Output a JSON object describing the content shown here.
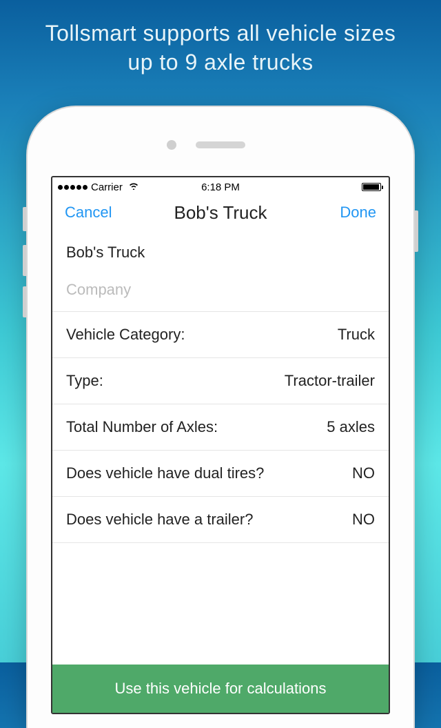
{
  "promo": {
    "line1": "Tollsmart supports all vehicle sizes",
    "line2": "up to 9 axle trucks"
  },
  "statusBar": {
    "carrier": "Carrier",
    "time": "6:18 PM"
  },
  "navBar": {
    "cancel": "Cancel",
    "title": "Bob's Truck",
    "done": "Done"
  },
  "form": {
    "vehicleName": "Bob's Truck",
    "companyPlaceholder": "Company",
    "rows": [
      {
        "label": "Vehicle Category:",
        "value": "Truck"
      },
      {
        "label": "Type:",
        "value": "Tractor-trailer"
      },
      {
        "label": "Total Number of Axles:",
        "value": "5 axles"
      },
      {
        "label": "Does vehicle have dual tires?",
        "value": "NO"
      },
      {
        "label": "Does vehicle have a trailer?",
        "value": "NO"
      }
    ]
  },
  "primaryButton": {
    "label": "Use this vehicle for calculations"
  }
}
